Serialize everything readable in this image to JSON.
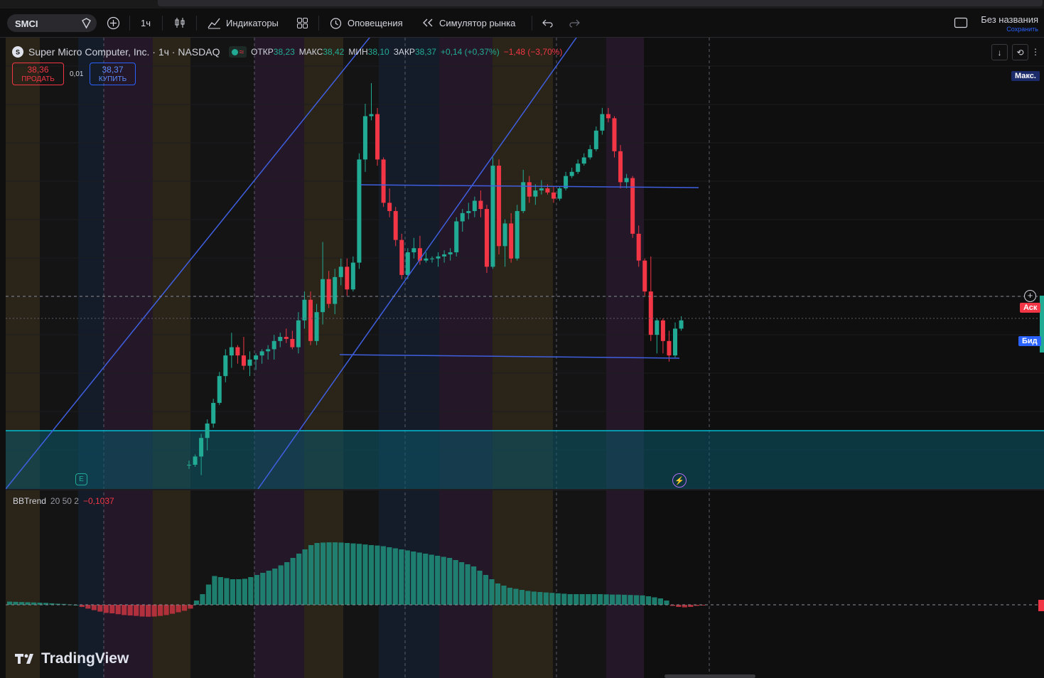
{
  "toolbar": {
    "symbol": "SMCI",
    "interval": "1ч",
    "indicators_label": "Индикаторы",
    "alerts_label": "Оповещения",
    "simulator_label": "Симулятор рынка",
    "layout_name": "Без названия",
    "save_label": "Сохранить"
  },
  "legend": {
    "name": "Super Micro Computer, Inc. · 1ч · NASDAQ",
    "open_label": "ОТКР",
    "open": "38,23",
    "high_label": "МАКС",
    "high": "38,42",
    "low_label": "МИН",
    "low": "38,10",
    "close_label": "ЗАКР",
    "close": "38,37",
    "change": "+0,14 (+0,37%)",
    "day_change": "−1,48 (−3,70%)"
  },
  "trade": {
    "sell_price": "38,36",
    "sell_label": "ПРОДАТЬ",
    "spread": "0,01",
    "buy_price": "38,37",
    "buy_label": "КУПИТЬ"
  },
  "price_tags": {
    "max": "Макс.",
    "ask": "Аск",
    "bid": "Бид"
  },
  "indicator": {
    "name": "BBTrend",
    "params": "20 50 2",
    "value": "−0,1037"
  },
  "brand": "TradingView",
  "earnings_badge": "E",
  "colors": {
    "up": "#22ab94",
    "down": "#f23645",
    "line": "#3f5fe0",
    "cyan": "#00bcd4"
  },
  "chart_data": {
    "type": "candlestick",
    "candles": [
      [
        45.0,
        45.2,
        44.8,
        45.0
      ],
      [
        45.0,
        45.5,
        44.9,
        45.4
      ],
      [
        45.4,
        46.5,
        44.5,
        46.3
      ],
      [
        46.3,
        47.2,
        45.7,
        47.0
      ],
      [
        47.0,
        48.2,
        46.8,
        48.0
      ],
      [
        48.0,
        49.5,
        47.9,
        49.3
      ],
      [
        49.3,
        50.6,
        49.0,
        50.3
      ],
      [
        50.3,
        51.4,
        49.7,
        50.7
      ],
      [
        50.7,
        50.8,
        49.9,
        50.3
      ],
      [
        50.3,
        51.2,
        49.6,
        49.8
      ],
      [
        49.8,
        50.5,
        49.3,
        50.1
      ],
      [
        50.1,
        50.4,
        49.6,
        50.3
      ],
      [
        50.3,
        50.6,
        49.9,
        50.5
      ],
      [
        50.5,
        50.8,
        50.1,
        50.6
      ],
      [
        50.6,
        51.3,
        50.1,
        51.0
      ],
      [
        51.0,
        51.4,
        50.7,
        51.2
      ],
      [
        51.2,
        51.6,
        50.9,
        51.1
      ],
      [
        51.1,
        51.5,
        50.6,
        50.7
      ],
      [
        50.7,
        52.4,
        50.4,
        52.0
      ],
      [
        52.0,
        53.4,
        51.6,
        53.0
      ],
      [
        53.0,
        53.4,
        50.8,
        51.0
      ],
      [
        51.0,
        52.8,
        50.8,
        52.4
      ],
      [
        52.4,
        55.8,
        51.8,
        54.0
      ],
      [
        54.0,
        54.4,
        52.6,
        52.8
      ],
      [
        52.8,
        54.5,
        52.3,
        54.1
      ],
      [
        54.1,
        55.0,
        53.7,
        54.6
      ],
      [
        54.6,
        55.0,
        53.2,
        53.5
      ],
      [
        53.5,
        55.1,
        53.4,
        54.8
      ],
      [
        54.8,
        60.1,
        54.5,
        59.8
      ],
      [
        59.8,
        62.5,
        59.2,
        61.9
      ],
      [
        61.9,
        63.5,
        61.7,
        62.0
      ],
      [
        62.0,
        62.3,
        59.5,
        59.8
      ],
      [
        59.8,
        59.9,
        57.5,
        57.7
      ],
      [
        57.7,
        58.4,
        57.0,
        57.3
      ],
      [
        57.3,
        57.5,
        55.6,
        55.9
      ],
      [
        55.9,
        56.2,
        54.0,
        54.2
      ],
      [
        54.2,
        55.5,
        54.0,
        55.3
      ],
      [
        55.3,
        56.0,
        55.0,
        55.5
      ],
      [
        55.5,
        56.1,
        54.7,
        54.9
      ],
      [
        54.9,
        55.3,
        54.8,
        55.0
      ],
      [
        55.0,
        55.1,
        54.8,
        55.0
      ],
      [
        55.0,
        55.3,
        54.6,
        55.1
      ],
      [
        55.1,
        55.4,
        54.8,
        55.2
      ],
      [
        55.2,
        55.5,
        54.9,
        55.3
      ],
      [
        55.3,
        57.0,
        55.1,
        56.8
      ],
      [
        56.8,
        57.4,
        56.3,
        57.2
      ],
      [
        57.2,
        57.7,
        56.9,
        57.3
      ],
      [
        57.3,
        58.0,
        57.0,
        57.8
      ],
      [
        57.8,
        58.3,
        57.0,
        57.4
      ],
      [
        57.4,
        57.6,
        54.3,
        54.6
      ],
      [
        54.6,
        59.9,
        54.5,
        59.5
      ],
      [
        59.5,
        59.8,
        55.2,
        55.6
      ],
      [
        55.6,
        56.9,
        54.6,
        56.7
      ],
      [
        56.7,
        57.2,
        54.8,
        55.0
      ],
      [
        55.0,
        57.6,
        54.9,
        57.3
      ],
      [
        57.3,
        59.3,
        57.2,
        58.7
      ],
      [
        58.7,
        59.0,
        57.7,
        58.0
      ],
      [
        58.0,
        58.6,
        57.6,
        58.3
      ],
      [
        58.3,
        58.8,
        58.1,
        58.4
      ],
      [
        58.4,
        58.6,
        58.1,
        58.2
      ],
      [
        58.2,
        58.5,
        57.7,
        57.9
      ],
      [
        57.9,
        58.5,
        57.8,
        58.4
      ],
      [
        58.4,
        59.2,
        58.3,
        59.0
      ],
      [
        59.0,
        59.4,
        58.9,
        59.2
      ],
      [
        59.2,
        59.8,
        59.1,
        59.6
      ],
      [
        59.6,
        60.1,
        59.5,
        59.9
      ],
      [
        59.9,
        60.5,
        59.8,
        60.3
      ],
      [
        60.3,
        61.4,
        60.2,
        61.2
      ],
      [
        61.2,
        62.3,
        61.0,
        62.0
      ],
      [
        62.0,
        62.3,
        61.6,
        61.8
      ],
      [
        61.8,
        61.9,
        59.9,
        60.2
      ],
      [
        60.2,
        60.5,
        58.4,
        58.7
      ],
      [
        58.7,
        59.1,
        58.4,
        58.9
      ],
      [
        58.9,
        59.0,
        56.0,
        56.2
      ],
      [
        56.2,
        56.6,
        54.6,
        54.9
      ],
      [
        54.9,
        55.0,
        53.2,
        53.4
      ],
      [
        53.4,
        55.1,
        51.0,
        51.3
      ],
      [
        51.3,
        52.1,
        50.4,
        52.0
      ],
      [
        52.0,
        52.1,
        50.4,
        51.0
      ],
      [
        51.0,
        51.5,
        50.0,
        50.3
      ],
      [
        50.3,
        51.9,
        50.2,
        51.6
      ],
      [
        51.6,
        52.2,
        51.5,
        52.0
      ]
    ],
    "indicator_series": {
      "name": "BBTrend",
      "values": [
        0.15,
        0.14,
        0.13,
        0.12,
        0.11,
        0.1,
        0.09,
        0.07,
        0.05,
        0.04,
        0.02,
        0.0,
        -0.1,
        -0.18,
        -0.25,
        -0.32,
        -0.38,
        -0.4,
        -0.44,
        -0.48,
        -0.5,
        -0.52,
        -0.55,
        -0.56,
        -0.55,
        -0.52,
        -0.48,
        -0.42,
        -0.35,
        -0.28,
        -0.18,
        0.2,
        0.5,
        0.95,
        1.35,
        1.3,
        1.25,
        1.2,
        1.2,
        1.22,
        1.3,
        1.4,
        1.5,
        1.6,
        1.7,
        1.85,
        2.0,
        2.2,
        2.4,
        2.6,
        2.8,
        2.9,
        2.92,
        2.93,
        2.93,
        2.92,
        2.9,
        2.88,
        2.86,
        2.83,
        2.8,
        2.78,
        2.75,
        2.7,
        2.65,
        2.6,
        2.55,
        2.5,
        2.45,
        2.4,
        2.35,
        2.3,
        2.25,
        2.2,
        2.1,
        2.0,
        1.9,
        1.8,
        1.6,
        1.4,
        1.2,
        1.0,
        0.9,
        0.8,
        0.75,
        0.7,
        0.65,
        0.62,
        0.6,
        0.58,
        0.56,
        0.54,
        0.52,
        0.5,
        0.5,
        0.5,
        0.5,
        0.5,
        0.5,
        0.49,
        0.48,
        0.48,
        0.47,
        0.46,
        0.45,
        0.44,
        0.4,
        0.35,
        0.3,
        0.2,
        -0.05,
        -0.1,
        -0.12,
        -0.1,
        -0.05,
        -0.03
      ]
    }
  }
}
